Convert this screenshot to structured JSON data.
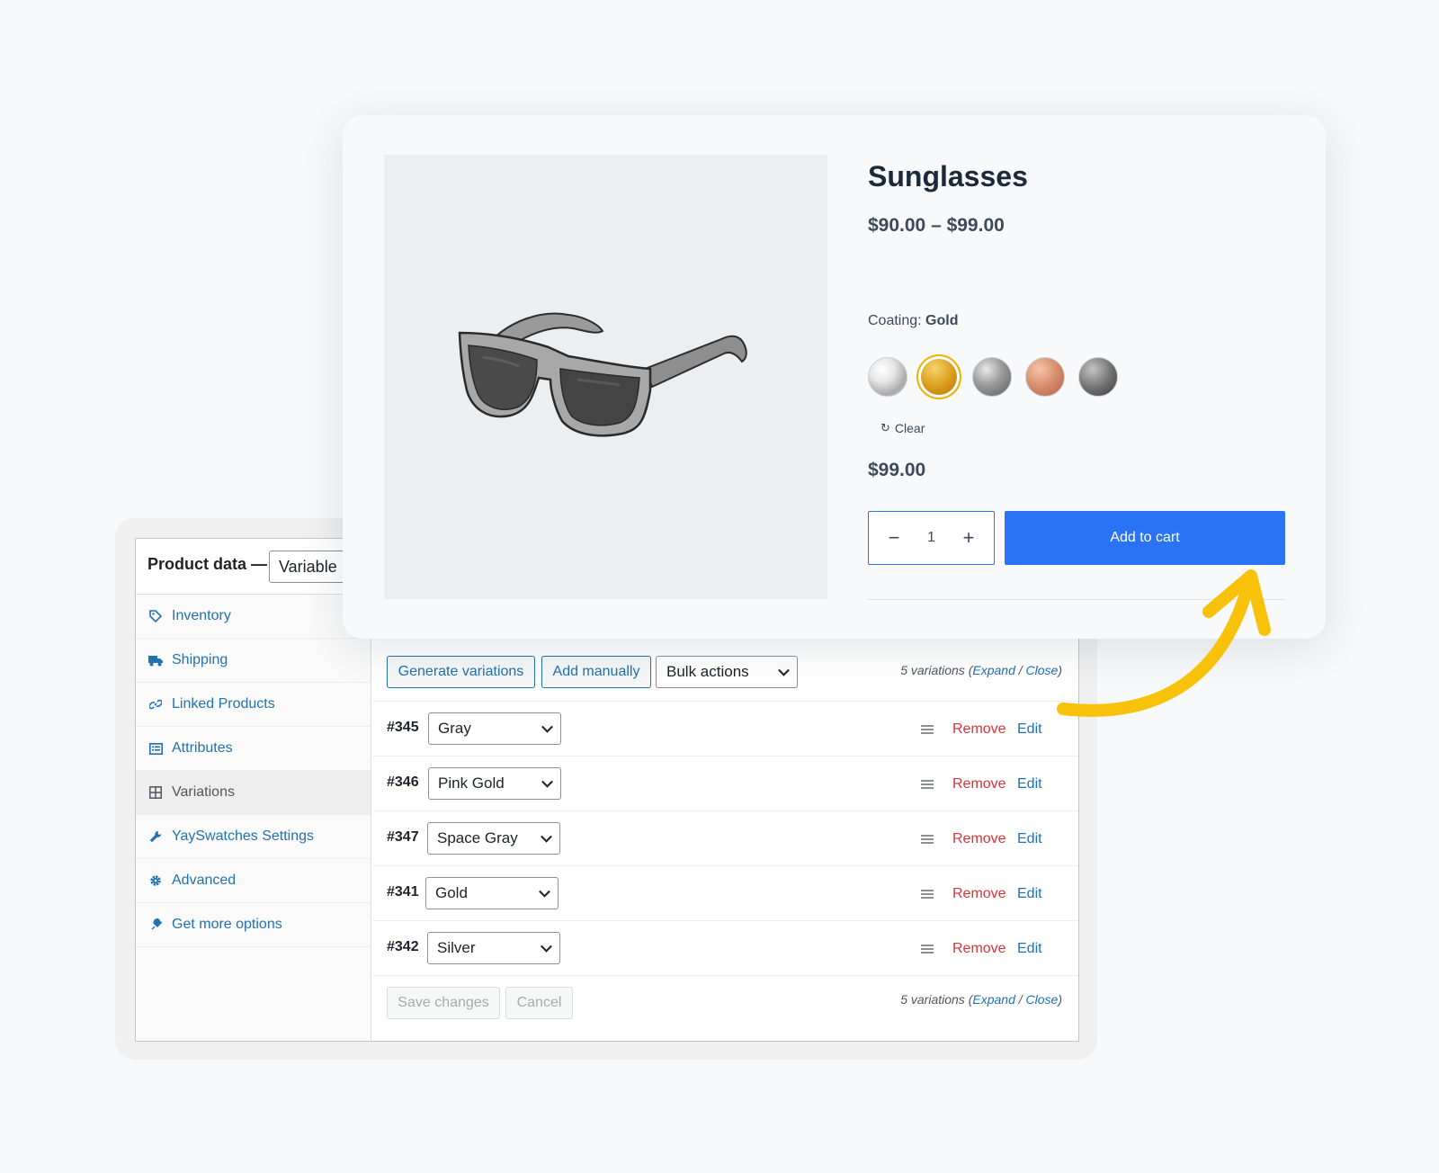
{
  "product": {
    "title": "Sunglasses",
    "price_range": "$90.00 – $99.00",
    "coating_label": "Coating:",
    "coating_value": "Gold",
    "swatches": [
      {
        "name": "Silver",
        "selected": false
      },
      {
        "name": "Gold",
        "selected": true
      },
      {
        "name": "Space Gray",
        "selected": false
      },
      {
        "name": "Pink Gold",
        "selected": false
      },
      {
        "name": "Gray",
        "selected": false
      }
    ],
    "clear_label": "Clear",
    "current_price": "$99.00",
    "quantity": "1",
    "qty_minus": "−",
    "qty_plus": "+",
    "add_to_cart_label": "Add to cart"
  },
  "admin": {
    "product_data_label": "Product data —",
    "product_type": "Variable",
    "tabs": [
      {
        "label": "Inventory",
        "icon": "tag-icon"
      },
      {
        "label": "Shipping",
        "icon": "truck-icon"
      },
      {
        "label": "Linked Products",
        "icon": "link-icon"
      },
      {
        "label": "Attributes",
        "icon": "list-icon"
      },
      {
        "label": "Variations",
        "icon": "grid-icon",
        "active": true
      },
      {
        "label": "YaySwatches Settings",
        "icon": "wrench-icon"
      },
      {
        "label": "Advanced",
        "icon": "gear-icon"
      },
      {
        "label": "Get more options",
        "icon": "plugin-icon"
      }
    ],
    "toolbar": {
      "generate_label": "Generate variations",
      "add_manually_label": "Add manually",
      "bulk_actions_label": "Bulk actions"
    },
    "variation_count": {
      "text": "5 variations",
      "open_paren": "(",
      "expand": "Expand",
      "sep": " / ",
      "close": "Close",
      "close_paren": ")"
    },
    "variations": [
      {
        "id": "#345",
        "value": "Gray"
      },
      {
        "id": "#346",
        "value": "Pink Gold"
      },
      {
        "id": "#347",
        "value": "Space Gray"
      },
      {
        "id": "#341",
        "value": "Gold"
      },
      {
        "id": "#342",
        "value": "Silver"
      }
    ],
    "remove_label": "Remove",
    "edit_label": "Edit",
    "save_label": "Save changes",
    "cancel_label": "Cancel"
  },
  "colors": {
    "accent": "#2b73f5",
    "wp_link": "#2271b1",
    "remove": "#d63638",
    "highlight": "#f8c20a"
  }
}
